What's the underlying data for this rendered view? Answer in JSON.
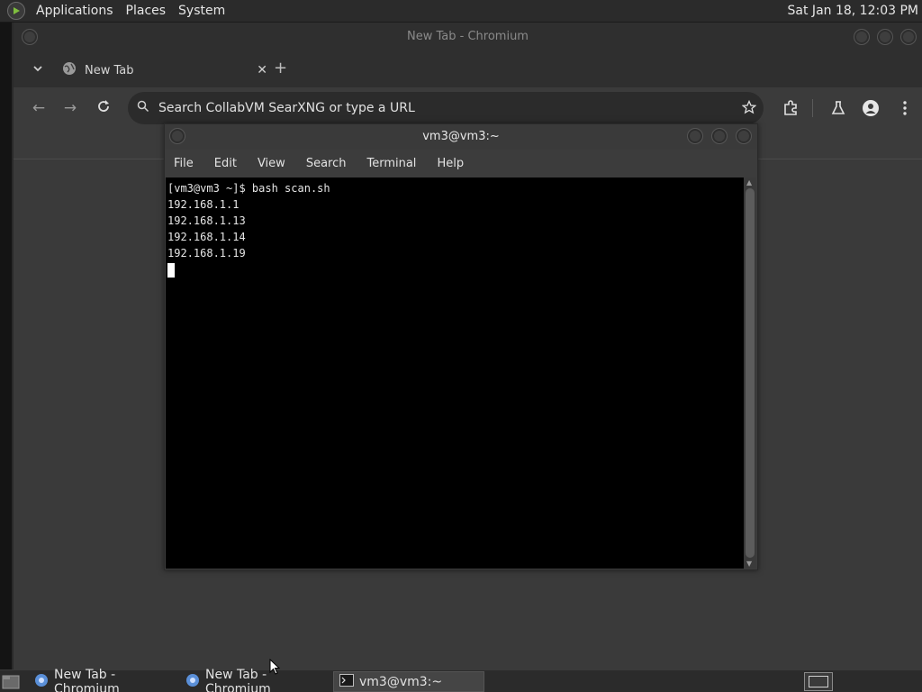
{
  "top_panel": {
    "menus": [
      "Applications",
      "Places",
      "System"
    ],
    "clock": "Sat Jan 18, 12:03 PM"
  },
  "chromium": {
    "window_title": "New Tab - Chromium",
    "tab": {
      "title": "New Tab"
    },
    "omnibox": {
      "placeholder": "Search CollabVM SearXNG or type a URL"
    },
    "icons": [
      "tab-dropdown-icon",
      "globe-icon",
      "close-icon",
      "plus-icon",
      "back-icon",
      "forward-icon",
      "reload-icon",
      "search-icon",
      "star-icon",
      "extensions-icon",
      "labs-icon",
      "profile-icon",
      "kebab-menu-icon"
    ]
  },
  "terminal": {
    "window_title": "vm3@vm3:~",
    "menus": [
      "File",
      "Edit",
      "View",
      "Search",
      "Terminal",
      "Help"
    ],
    "lines": [
      "[vm3@vm3 ~]$ bash scan.sh",
      "192.168.1.1",
      "192.168.1.13",
      "192.168.1.14",
      "192.168.1.19"
    ]
  },
  "taskbar": {
    "items": [
      {
        "label": "New Tab - Chromium",
        "active": false
      },
      {
        "label": "New Tab - Chromium",
        "active": false
      },
      {
        "label": "vm3@vm3:~",
        "active": true
      }
    ]
  },
  "colors": {
    "panel_bg": "#2b2b2b",
    "window_bg": "#3c3c3c",
    "terminal_bg": "#000000",
    "terminal_fg": "#e6e6e6"
  }
}
